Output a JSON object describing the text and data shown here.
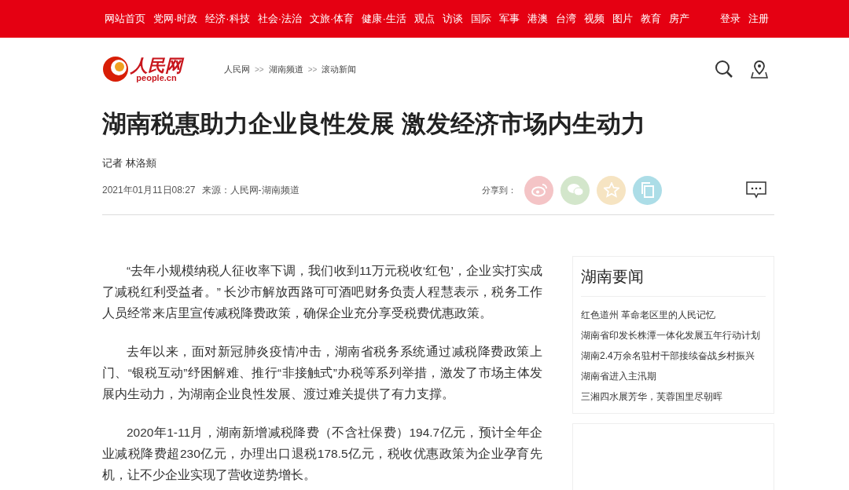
{
  "top_nav": {
    "items": [
      "网站首页",
      "党网·时政",
      "经济·科技",
      "社会·法治",
      "文旅·体育",
      "健康·生活",
      "观点",
      "访谈",
      "国际",
      "军事",
      "港澳",
      "台湾",
      "视频",
      "图片",
      "教育",
      "房产"
    ],
    "account": [
      "登录",
      "注册"
    ]
  },
  "header": {
    "logo": {
      "name": "人民网",
      "domain": "people.cn"
    },
    "breadcrumb": [
      {
        "kind": "link",
        "label": "人民网"
      },
      {
        "kind": "separator",
        "label": ">>"
      },
      {
        "kind": "link",
        "label": "湖南频道"
      },
      {
        "kind": "separator",
        "label": ">>"
      },
      {
        "kind": "link",
        "label": "滚动新闻"
      }
    ]
  },
  "article": {
    "title": "湖南税惠助力企业良性发展 激发经济市场内生动力",
    "byline": "记者 林洛頫",
    "date": "2021年01月11日08:27",
    "source": "来源：人民网-湖南频道",
    "share_label": "分享到：",
    "share": [
      {
        "kind": "weibo",
        "color": "#f4c4c6"
      },
      {
        "kind": "wechat",
        "color": "#d3e6cb"
      },
      {
        "kind": "favorite",
        "color": "#f6e4c2"
      },
      {
        "kind": "copy",
        "color": "#acdde7"
      }
    ],
    "paragraphs": [
      "“去年小规模纳税人征收率下调，我们收到11万元税收‘红包’，企业实打实成了减税红利受益者。” 长沙市解放西路可可酒吧财务负责人程慧表示，税务工作人员经常来店里宣传减税降费政策，确保企业充分享受税费优惠政策。",
      "去年以来，面对新冠肺炎疫情冲击，湖南省税务系统通过减税降费政策上门、“银税互动”纾困解难、推行“非接触式”办税等系列举措，激发了市场主体发展内生动力，为湖南企业良性发展、渡过难关提供了有力支撑。",
      "2020年1-11月，湖南新增减税降费（不含社保费）194.7亿元，预计全年企业减税降费超230亿元，办理出口退税178.5亿元，税收优惠政策为企业孕育先机，让不少企业实现了营收逆势增长。"
    ]
  },
  "sidebar": {
    "title": "湖南要闻",
    "items": [
      "红色道州 革命老区里的人民记忆",
      "湖南省印发长株潭一体化发展五年行动计划",
      "湖南2.4万余名驻村干部接续奋战乡村振兴",
      "湖南省进入主汛期",
      "三湘四水展芳华，芙蓉国里尽朝晖"
    ]
  }
}
